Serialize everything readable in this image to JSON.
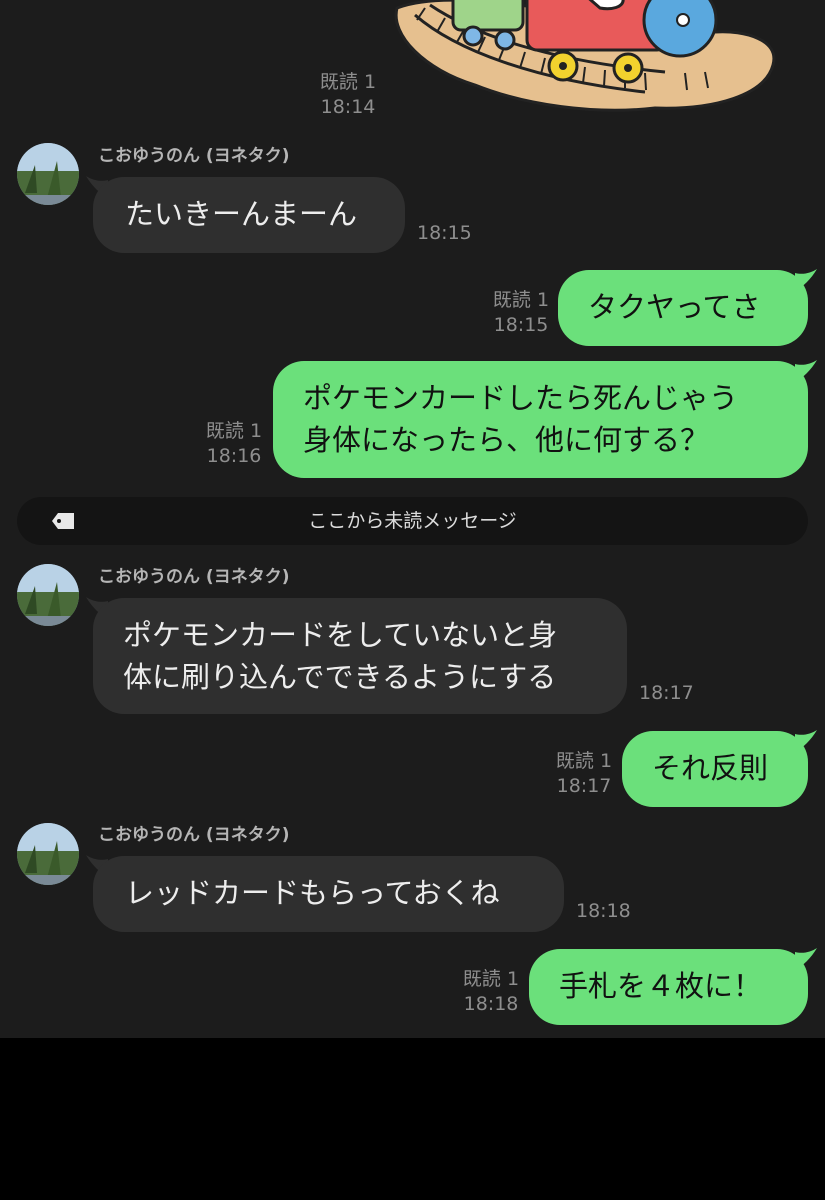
{
  "read_label": "既読 1",
  "sender_name": "こおゆうのん (ヨネタク)",
  "unread_divider": "ここから未読メッセージ",
  "messages": [
    {
      "time": "18:14"
    },
    {
      "text": "たいきーんまーん",
      "time": "18:15"
    },
    {
      "text": "タクヤってさ",
      "time": "18:15"
    },
    {
      "line1": "ポケモンカードしたら死んじゃう",
      "line2": "身体になったら、他に何する？",
      "time": "18:16"
    },
    {
      "line1": "ポケモンカードをしていないと身",
      "line2": "体に刷り込んでできるようにする",
      "time": "18:17"
    },
    {
      "text": "それ反則",
      "time": "18:17"
    },
    {
      "text": "レッドカードもらっておくね",
      "time": "18:18"
    },
    {
      "text": "手札を４枚に！",
      "time": "18:18"
    }
  ],
  "colors": {
    "background": "#1c1c1c",
    "incoming_bubble": "#2f2f2f",
    "outgoing_bubble": "#6be07b",
    "meta_text": "#8e8e8e"
  },
  "icons": [
    "train-sticker",
    "avatar-photo",
    "tag-icon"
  ]
}
